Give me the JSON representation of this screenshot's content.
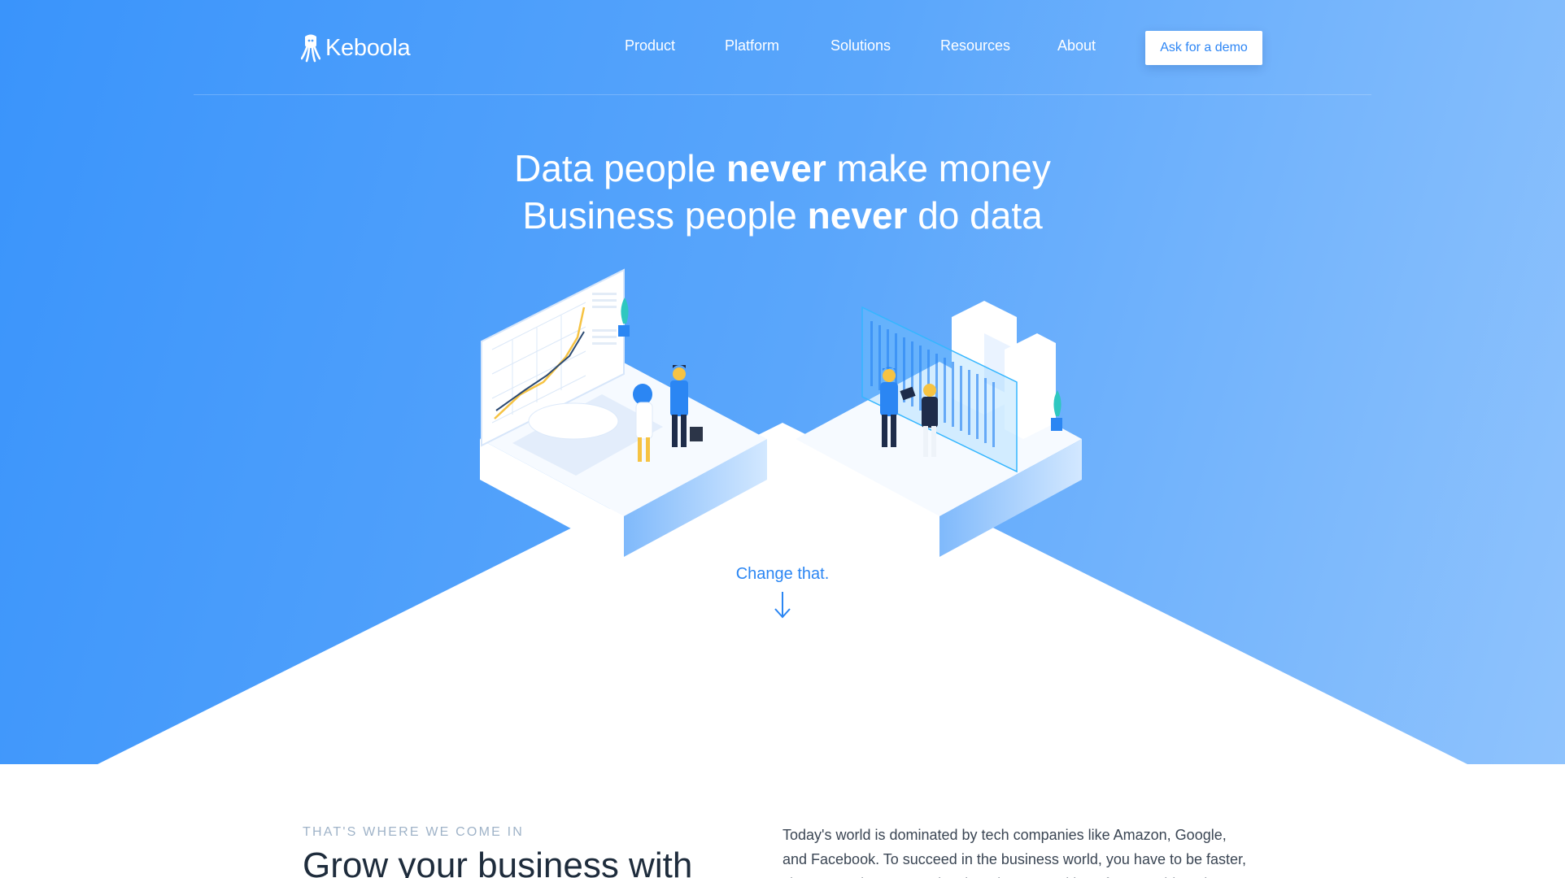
{
  "brand": {
    "name": "Keboola"
  },
  "nav": {
    "items": [
      {
        "label": "Product"
      },
      {
        "label": "Platform"
      },
      {
        "label": "Solutions"
      },
      {
        "label": "Resources"
      },
      {
        "label": "About"
      }
    ],
    "cta_label": "Ask for a demo"
  },
  "hero": {
    "line1_pre": "Data people ",
    "line1_bold": "never",
    "line1_post": " make money",
    "line2_pre": "Business people ",
    "line2_bold": "never",
    "line2_post": " do data",
    "cta_label": "Change that."
  },
  "section": {
    "eyebrow": "THAT'S WHERE WE COME IN",
    "title": "Grow your business with",
    "text": "Today's world is dominated by tech companies like Amazon, Google, and Facebook. To succeed in the business world, you have to be faster, cheaper and more creative than the competition. If you could tap into"
  },
  "colors": {
    "hero_start": "#3a94fb",
    "hero_end": "#8fc3fd",
    "accent": "#2b86f3",
    "illustration_yellow": "#f6c343",
    "illustration_teal": "#2ec7c0"
  },
  "icons": [
    "keboola-logo-icon",
    "arrow-down-icon"
  ]
}
